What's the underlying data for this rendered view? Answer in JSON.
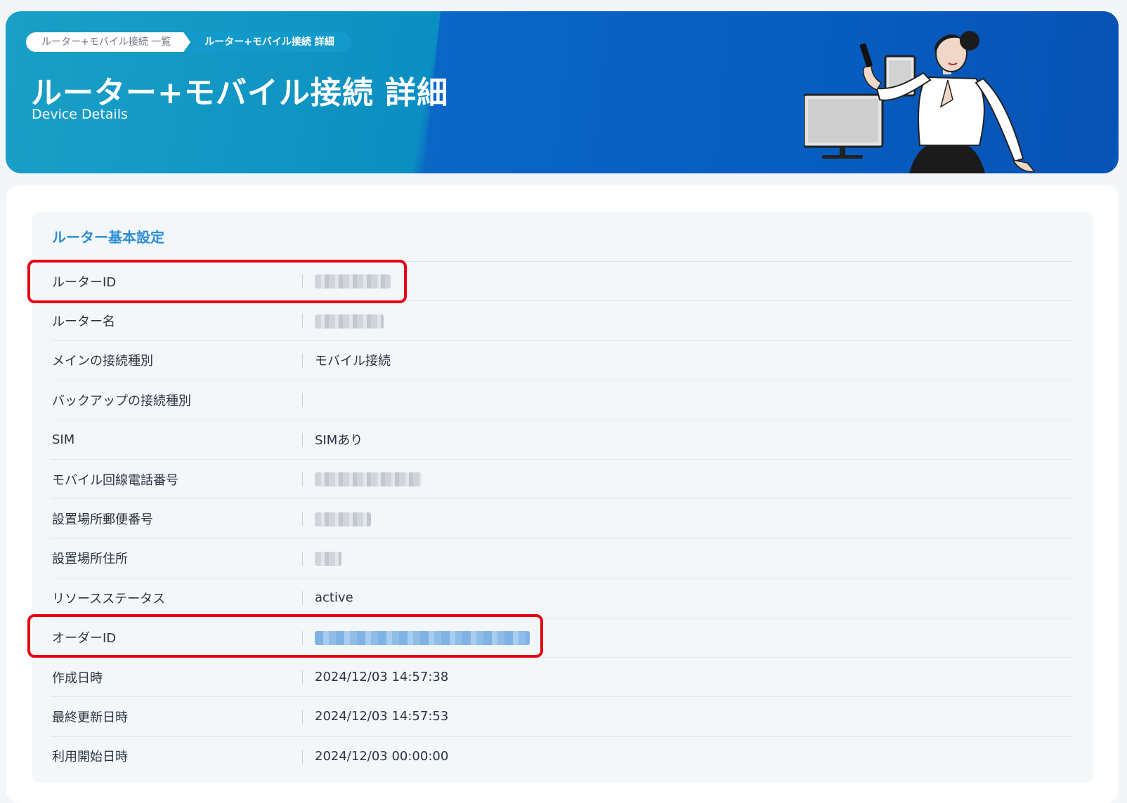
{
  "breadcrumb": [
    {
      "label": "ルーター+モバイル接続 一覧"
    },
    {
      "label": "ルーター+モバイル接続 詳細"
    }
  ],
  "header": {
    "title": "ルーター+モバイル接続 詳細",
    "subtitle": "Device Details"
  },
  "section": {
    "title": "ルーター基本設定"
  },
  "rows": [
    {
      "label": "ルーターID",
      "value": "",
      "masked": "gray"
    },
    {
      "label": "ルーター名",
      "value": "",
      "masked": "gray"
    },
    {
      "label": "メインの接続種別",
      "value": "モバイル接続"
    },
    {
      "label": "バックアップの接続種別",
      "value": ""
    },
    {
      "label": "SIM",
      "value": "SIMあり"
    },
    {
      "label": "モバイル回線電話番号",
      "value": "",
      "masked": "gray"
    },
    {
      "label": "設置場所郵便番号",
      "value": "",
      "masked": "gray"
    },
    {
      "label": "設置場所住所",
      "value": "",
      "masked": "gray"
    },
    {
      "label": "リソースステータス",
      "value": "active"
    },
    {
      "label": "オーダーID",
      "value": "",
      "masked": "blue"
    },
    {
      "label": "作成日時",
      "value": "2024/12/03 14:57:38"
    },
    {
      "label": "最終更新日時",
      "value": "2024/12/03 14:57:53"
    },
    {
      "label": "利用開始日時",
      "value": "2024/12/03 00:00:00"
    }
  ],
  "colors": {
    "accent": "#2b8ed6",
    "highlight": "#e50012",
    "hero_left": "#1aa0c6",
    "hero_right": "#0b56b8"
  }
}
